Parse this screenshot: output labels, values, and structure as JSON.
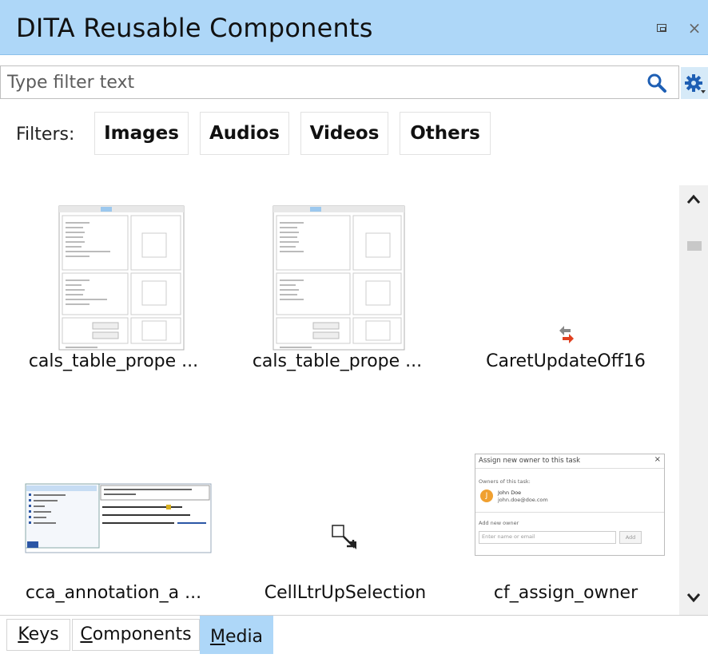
{
  "window": {
    "title": "DITA Reusable Components"
  },
  "filter": {
    "placeholder": "Type filter text"
  },
  "filters": {
    "label": "Filters:",
    "buttons": [
      "Images",
      "Audios",
      "Videos",
      "Others"
    ]
  },
  "items": [
    {
      "caption": "cals_table_prope ...",
      "icon": "table-properties-thumbnail"
    },
    {
      "caption": "cals_table_prope ...",
      "icon": "table-properties-thumbnail"
    },
    {
      "caption": "CaretUpdateOff16",
      "icon": "caret-update-icon"
    },
    {
      "caption": "cca_annotation_a ...",
      "icon": "annotation-thumbnail"
    },
    {
      "caption": "CellLtrUpSelection",
      "icon": "cell-selection-icon"
    },
    {
      "caption": "cf_assign_owner",
      "icon": "assign-owner-thumbnail"
    }
  ],
  "assign_dialog": {
    "title": "Assign new owner to this task",
    "owners_label": "Owners of this task:",
    "owner_name": "John Doe",
    "owner_email": "john.doe@doe.com",
    "add_label": "Add new owner",
    "input_placeholder": "Enter name or email",
    "add_button": "Add"
  },
  "tabs": [
    {
      "label": "Keys",
      "access": "K",
      "rest": "eys",
      "active": false
    },
    {
      "label": "Components",
      "access": "C",
      "rest": "omponents",
      "active": false
    },
    {
      "label": "Media",
      "access": "M",
      "rest": "edia",
      "active": true
    }
  ],
  "colors": {
    "titlebar": "#aed7f8",
    "accent": "#1e5fb4",
    "avatar": "#f0a030"
  }
}
